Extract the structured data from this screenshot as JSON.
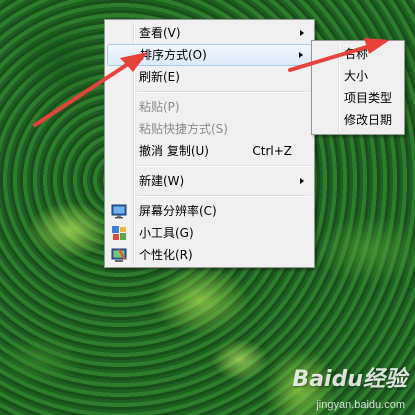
{
  "context_menu": {
    "items": [
      {
        "label": "查看(V)"
      },
      {
        "label": "排序方式(O)"
      },
      {
        "label": "刷新(E)"
      },
      {
        "label": "粘贴(P)"
      },
      {
        "label": "粘贴快捷方式(S)"
      },
      {
        "label": "撤消 复制(U)",
        "shortcut": "Ctrl+Z"
      },
      {
        "label": "新建(W)"
      },
      {
        "label": "屏幕分辨率(C)",
        "icon": "screen-resolution-icon"
      },
      {
        "label": "小工具(G)",
        "icon": "gadgets-icon"
      },
      {
        "label": "个性化(R)",
        "icon": "personalize-icon"
      }
    ]
  },
  "sort_submenu": {
    "items": [
      {
        "label": "名称"
      },
      {
        "label": "大小"
      },
      {
        "label": "项目类型"
      },
      {
        "label": "修改日期"
      }
    ]
  },
  "watermark": {
    "brand": "Baidu经验",
    "url": "jingyan.baidu.com"
  },
  "colors": {
    "annotation_arrow": "#e8433a",
    "menu_background": "#f0f0f0",
    "hover_border": "#a8c8ec"
  }
}
